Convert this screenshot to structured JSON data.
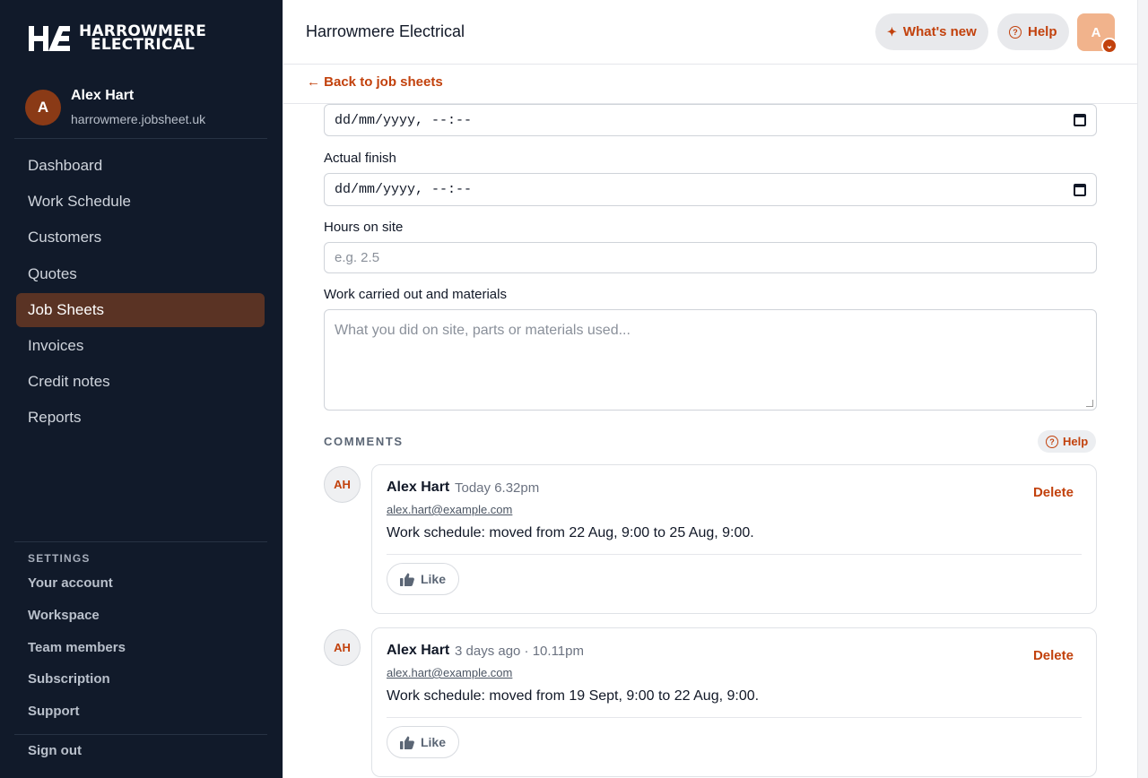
{
  "brand": {
    "line1": "HARROWMERE",
    "line2": "ELECTRICAL",
    "mark": "HE"
  },
  "user": {
    "initial": "A",
    "name": "Alex Hart",
    "domain": "harrowmere.jobsheet.uk"
  },
  "nav": [
    {
      "label": "Dashboard",
      "active": false
    },
    {
      "label": "Work Schedule",
      "active": false
    },
    {
      "label": "Customers",
      "active": false
    },
    {
      "label": "Quotes",
      "active": false
    },
    {
      "label": "Job Sheets",
      "active": true
    },
    {
      "label": "Invoices",
      "active": false
    },
    {
      "label": "Credit notes",
      "active": false
    },
    {
      "label": "Reports",
      "active": false
    }
  ],
  "settings": {
    "title": "SETTINGS",
    "items": [
      "Your account",
      "Workspace",
      "Team members",
      "Subscription",
      "Support"
    ],
    "sign_out": "Sign out"
  },
  "header": {
    "title": "Harrowmere Electrical",
    "whats_new": "What's new",
    "help": "Help",
    "account_initial": "A"
  },
  "back_link": "← Back to job sheets",
  "form": {
    "start_value": "dd/mm/yyyy, --:--",
    "actual_finish_label": "Actual finish",
    "actual_finish_value": "dd/mm/yyyy, --:--",
    "hours_label": "Hours on site",
    "hours_placeholder": "e.g. 2.5",
    "work_label": "Work carried out and materials",
    "work_placeholder": "What you did on site, parts or materials used..."
  },
  "comments": {
    "title": "COMMENTS",
    "help": "Help",
    "items": [
      {
        "initials": "AH",
        "name": "Alex Hart",
        "time": "Today 6.32pm",
        "email": "alex.hart@example.com",
        "text": "Work schedule: moved from 22 Aug, 9:00 to 25 Aug, 9:00.",
        "delete": "Delete",
        "like": "Like"
      },
      {
        "initials": "AH",
        "name": "Alex Hart",
        "time": "3 days ago · 10.11pm",
        "email": "alex.hart@example.com",
        "text": "Work schedule: moved from 19 Sept, 9:00 to 22 Aug, 9:00.",
        "delete": "Delete",
        "like": "Like"
      }
    ]
  },
  "colors": {
    "sidebar_bg": "#111a2a",
    "accent": "#c2410c",
    "active_nav": "#5a3324"
  },
  "icons": [
    "sparkle-icon",
    "help-circle-icon",
    "chevron-down-icon",
    "calendar-icon",
    "thumbs-up-icon",
    "arrow-left-icon"
  ]
}
